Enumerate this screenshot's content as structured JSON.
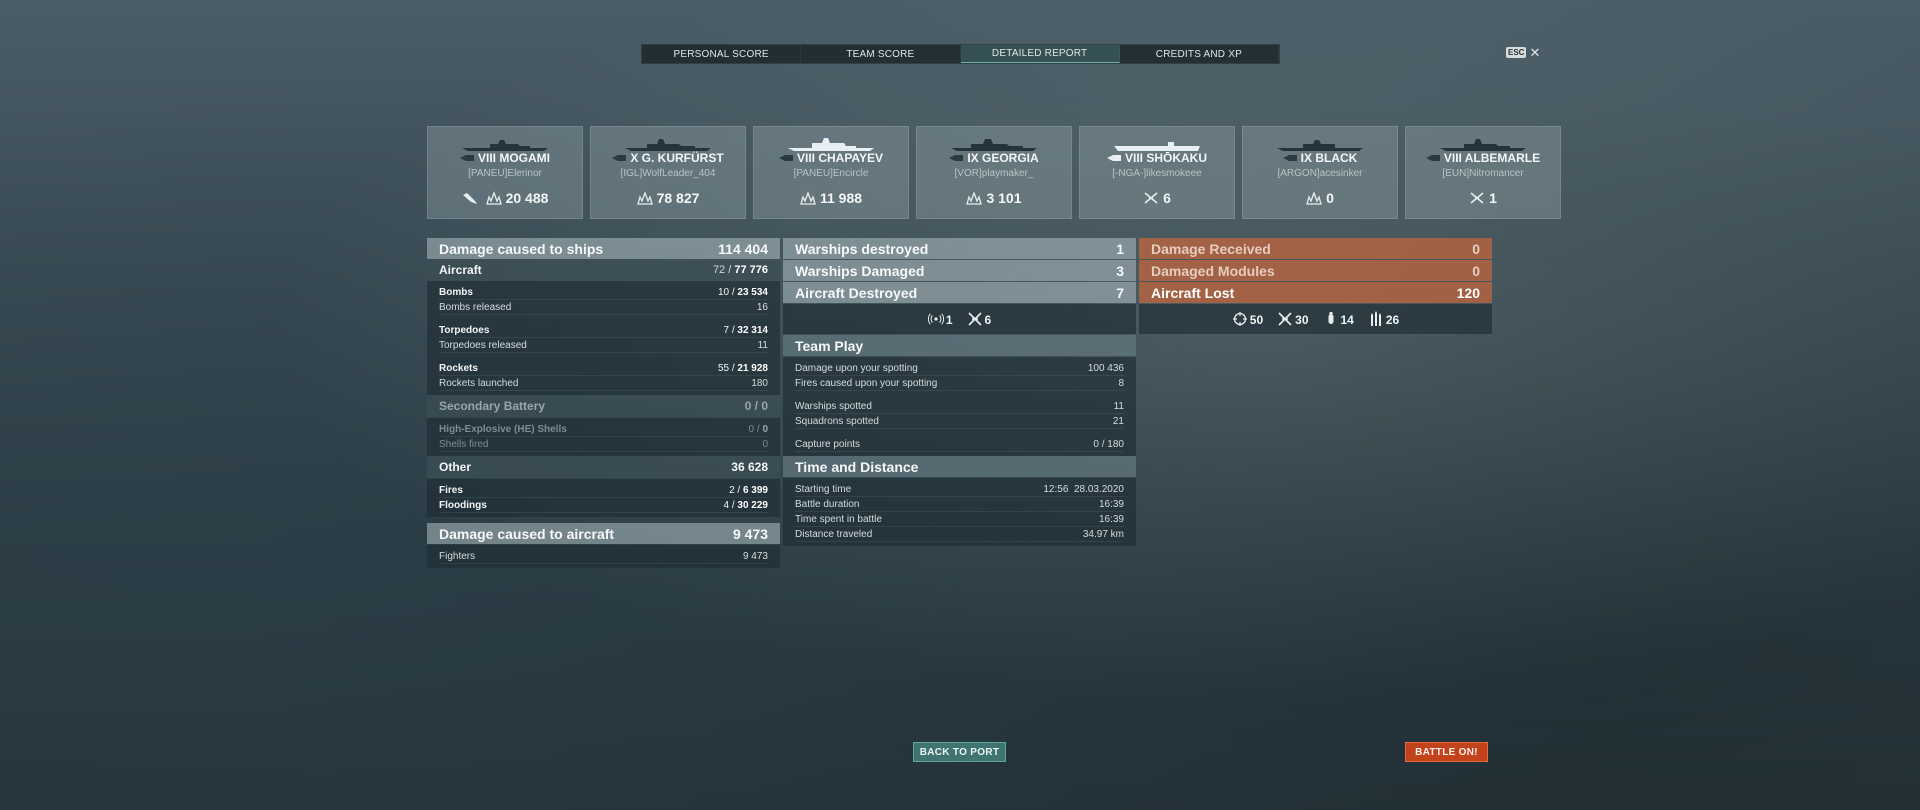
{
  "tabs": [
    {
      "label": "PERSONAL SCORE"
    },
    {
      "label": "TEAM SCORE"
    },
    {
      "label": "DETAILED REPORT"
    },
    {
      "label": "CREDITS AND XP"
    }
  ],
  "esc": {
    "key": "ESC",
    "close": "✕"
  },
  "ships": [
    {
      "name": "VIII MOGAMI",
      "player": "[PANEU]Elerinor",
      "stats": [
        {
          "icon": "plane-shot-icon",
          "value": ""
        },
        {
          "icon": "damage-icon",
          "value": "20 488"
        }
      ]
    },
    {
      "name": "X G. KURFÜRST",
      "player": "[IGL]WolfLeader_404",
      "stats": [
        {
          "icon": "damage-icon",
          "value": "78 827"
        }
      ]
    },
    {
      "name": "VIII CHAPAYEV",
      "player": "[PANEU]Encircle",
      "stats": [
        {
          "icon": "damage-icon",
          "value": "11 988"
        }
      ]
    },
    {
      "name": "IX GEORGIA",
      "player": "[VOR]playmaker_",
      "stats": [
        {
          "icon": "damage-icon",
          "value": "3 101"
        }
      ]
    },
    {
      "name": "VIII SHŌKAKU",
      "player": "[-NGA-]likesmokeee",
      "stats": [
        {
          "icon": "aircraft-destroyed-icon",
          "value": "6"
        }
      ]
    },
    {
      "name": "IX BLACK",
      "player": "[ARGON]acesinker",
      "stats": [
        {
          "icon": "damage-icon",
          "value": "0"
        }
      ]
    },
    {
      "name": "VIII ALBEMARLE",
      "player": "[EUN]Nitromancer",
      "stats": [
        {
          "icon": "aircraft-destroyed-icon",
          "value": "1"
        }
      ]
    }
  ],
  "col1": {
    "damage_ships": {
      "label": "Damage caused to ships",
      "value": "114 404"
    },
    "aircraft": {
      "label": "Aircraft",
      "value_a": "72 / ",
      "value_b": "77 776"
    },
    "bombs": {
      "label": "Bombs",
      "value_a": "10 / ",
      "value_b": "23 534"
    },
    "bombs_released": {
      "label": "Bombs released",
      "value": "16"
    },
    "torpedoes": {
      "label": "Torpedoes",
      "value_a": "7 / ",
      "value_b": "32 314"
    },
    "torpedoes_released": {
      "label": "Torpedoes released",
      "value": "11"
    },
    "rockets": {
      "label": "Rockets",
      "value_a": "55 / ",
      "value_b": "21 928"
    },
    "rockets_launched": {
      "label": "Rockets launched",
      "value": "180"
    },
    "secondary": {
      "label": "Secondary Battery",
      "value": "0 / 0"
    },
    "he_shells": {
      "label": "High-Explosive (HE) Shells",
      "value_a": "0 / ",
      "value_b": "0"
    },
    "shells_fired": {
      "label": "Shells fired",
      "value": "0"
    },
    "other": {
      "label": "Other",
      "value": "36 628"
    },
    "fires": {
      "label": "Fires",
      "value_a": "2 / ",
      "value_b": "6 399"
    },
    "floodings": {
      "label": "Floodings",
      "value_a": "4 / ",
      "value_b": "30 229"
    },
    "damage_aircraft": {
      "label": "Damage caused to aircraft",
      "value": "9 473"
    },
    "fighters": {
      "label": "Fighters",
      "value": "9 473"
    }
  },
  "col2": {
    "warships_destroyed": {
      "label": "Warships destroyed",
      "value": "1"
    },
    "warships_damaged": {
      "label": "Warships Damaged",
      "value": "3"
    },
    "aircraft_destroyed": {
      "label": "Aircraft Destroyed",
      "value": "7"
    },
    "icons": [
      {
        "icon": "spotting-icon",
        "value": "1"
      },
      {
        "icon": "aircraft-destroyed-icon",
        "value": "6"
      }
    ],
    "team_play": {
      "label": "Team Play"
    },
    "dmg_spotting": {
      "label": "Damage upon your spotting",
      "value": "100 436"
    },
    "fires_spotting": {
      "label": "Fires caused upon your spotting",
      "value": "8"
    },
    "warships_spotted": {
      "label": "Warships spotted",
      "value": "11"
    },
    "squadrons_spotted": {
      "label": "Squadrons spotted",
      "value": "21"
    },
    "capture_points": {
      "label": "Capture points",
      "value": "0 / 180"
    },
    "time_distance": {
      "label": "Time and Distance"
    },
    "starting_time": {
      "label": "Starting time",
      "value": "12:56  28.03.2020"
    },
    "battle_duration": {
      "label": "Battle duration",
      "value": "16:39"
    },
    "time_spent": {
      "label": "Time spent in battle",
      "value": "16:39"
    },
    "distance": {
      "label": "Distance traveled",
      "value": "34.97 km"
    }
  },
  "col3": {
    "damage_received": {
      "label": "Damage Received",
      "value": "0"
    },
    "damaged_modules": {
      "label": "Damaged Modules",
      "value": "0"
    },
    "aircraft_lost": {
      "label": "Aircraft Lost",
      "value": "120"
    },
    "icons": [
      {
        "icon": "crosshair-icon",
        "value": "50"
      },
      {
        "icon": "aircraft-destroyed-icon",
        "value": "30"
      },
      {
        "icon": "bomb-icon",
        "value": "14"
      },
      {
        "icon": "rockets-icon",
        "value": "26"
      }
    ]
  },
  "buttons": {
    "back": "BACK TO PORT",
    "battle": "BATTLE ON!"
  }
}
